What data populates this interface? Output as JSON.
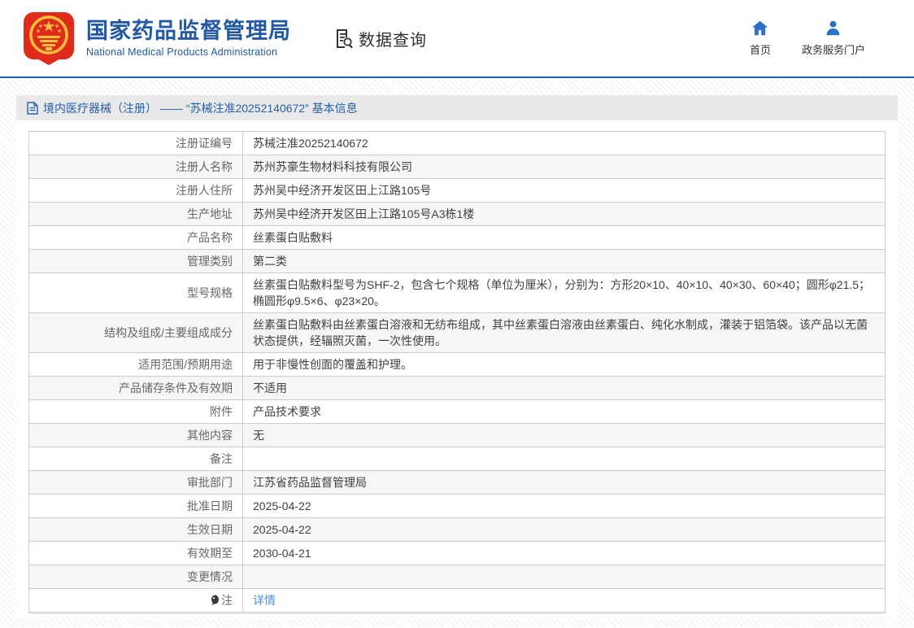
{
  "header": {
    "org_title": "国家药品监督管理局",
    "org_subtitle": "National Medical Products Administration",
    "section_label": "数据查询",
    "nav": {
      "home_label": "首页",
      "portal_label": "政务服务门户"
    }
  },
  "breadcrumb": {
    "text": "境内医疗器械（注册） —— “苏械注准20252140672” 基本信息"
  },
  "table": {
    "rows": [
      {
        "label": "注册证编号",
        "value": "苏械注准20252140672"
      },
      {
        "label": "注册人名称",
        "value": "苏州苏豪生物材料科技有限公司"
      },
      {
        "label": "注册人住所",
        "value": "苏州吴中经济开发区田上江路105号"
      },
      {
        "label": "生产地址",
        "value": "苏州吴中经济开发区田上江路105号A3栋1楼"
      },
      {
        "label": "产品名称",
        "value": "丝素蛋白贴敷料"
      },
      {
        "label": "管理类别",
        "value": "第二类"
      },
      {
        "label": "型号规格",
        "value": "丝素蛋白贴敷料型号为SHF-2，包含七个规格（单位为厘米），分别为：方形20×10、40×10、40×30、60×40；圆形φ21.5；椭圆形φ9.5×6、φ23×20。"
      },
      {
        "label": "结构及组成/主要组成成分",
        "value": "丝素蛋白贴敷料由丝素蛋白溶液和无纺布组成，其中丝素蛋白溶液由丝素蛋白、纯化水制成，灌装于铝箔袋。该产品以无菌状态提供，经辐照灭菌，一次性使用。"
      },
      {
        "label": "适用范围/预期用途",
        "value": "用于非慢性创面的覆盖和护理。"
      },
      {
        "label": "产品储存条件及有效期",
        "value": "不适用"
      },
      {
        "label": "附件",
        "value": "产品技术要求"
      },
      {
        "label": "其他内容",
        "value": "无"
      },
      {
        "label": "备注",
        "value": ""
      },
      {
        "label": "审批部门",
        "value": "江苏省药品监督管理局"
      },
      {
        "label": "批准日期",
        "value": "2025-04-22"
      },
      {
        "label": "生效日期",
        "value": "2025-04-22"
      },
      {
        "label": "有效期至",
        "value": "2030-04-21"
      },
      {
        "label": "变更情况",
        "value": ""
      },
      {
        "label": "注",
        "label_icon": "bulb-icon",
        "value": "详情",
        "value_type": "link"
      }
    ]
  },
  "colors": {
    "brand_blue": "#2358a7",
    "divider_blue": "#1d64b5",
    "breadcrumb_blue": "#2460ad",
    "link_blue": "#4a90e2",
    "nav_icon_blue": "#2a6fc8",
    "title_bar_bg": "#e9e9e9",
    "striped_row_bg": "#f6f6f6",
    "table_border": "#cccccc",
    "emblem_red": "#de2b1c",
    "emblem_gold": "#f5c23c"
  }
}
